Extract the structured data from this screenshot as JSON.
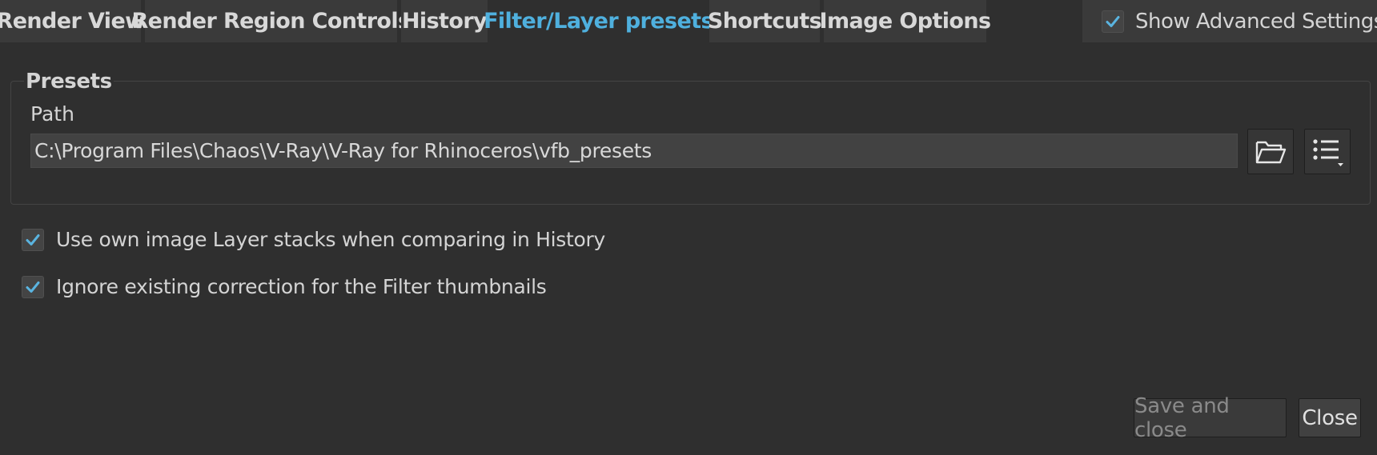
{
  "tabs": [
    {
      "label": "Render View",
      "active": false
    },
    {
      "label": "Render Region Controls",
      "active": false
    },
    {
      "label": "History",
      "active": false
    },
    {
      "label": "Filter/Layer presets",
      "active": true
    },
    {
      "label": "Shortcuts",
      "active": false
    },
    {
      "label": "Image Options",
      "active": false
    }
  ],
  "advanced": {
    "label": "Show Advanced Settings",
    "checked": true
  },
  "presets": {
    "group_title": "Presets",
    "path_label": "Path",
    "path_value": "C:\\Program Files\\Chaos\\V-Ray\\V-Ray for Rhinoceros\\vfb_presets",
    "browse_icon": "folder-open-icon",
    "menu_icon": "list-menu-icon"
  },
  "options": [
    {
      "label": "Use own image Layer stacks when comparing in History",
      "checked": true
    },
    {
      "label": "Ignore existing correction for the Filter thumbnails",
      "checked": true
    }
  ],
  "buttons": {
    "save_close": {
      "label": "Save and close",
      "enabled": false
    },
    "close": {
      "label": "Close",
      "enabled": true
    }
  },
  "colors": {
    "background": "#2f2f2f",
    "tab_background": "#3a3a3a",
    "active_tab_text": "#4fb0de",
    "check_mark": "#5ab4e0"
  }
}
